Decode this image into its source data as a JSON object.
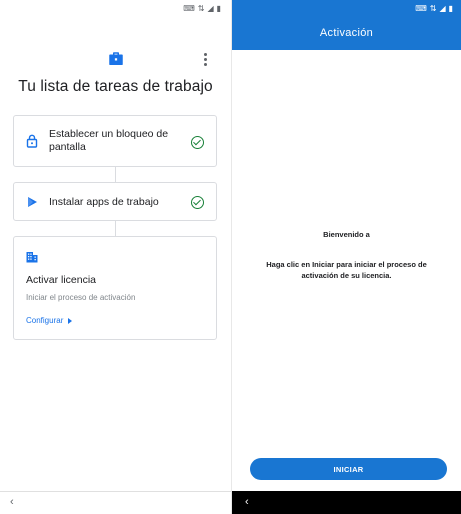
{
  "left": {
    "title": "Tu lista de tareas de trabajo",
    "cards": {
      "lock": {
        "label": "Establecer un bloqueo de pantalla"
      },
      "apps": {
        "label": "Instalar apps de trabajo"
      },
      "license": {
        "title": "Activar licencia",
        "subtitle": "Iniciar el proceso de activación",
        "link": "Configurar"
      }
    },
    "back_glyph": "‹"
  },
  "right": {
    "app_title": "Activación",
    "welcome": "Bienvenido a",
    "message": "Haga clic en Iniciar para iniciar el proceso de activación de su licencia.",
    "start_button": "INICIAR",
    "back_glyph": "‹"
  },
  "colors": {
    "accent_blue": "#1976d2",
    "link_blue": "#1a73e8",
    "check_green": "#188038"
  }
}
